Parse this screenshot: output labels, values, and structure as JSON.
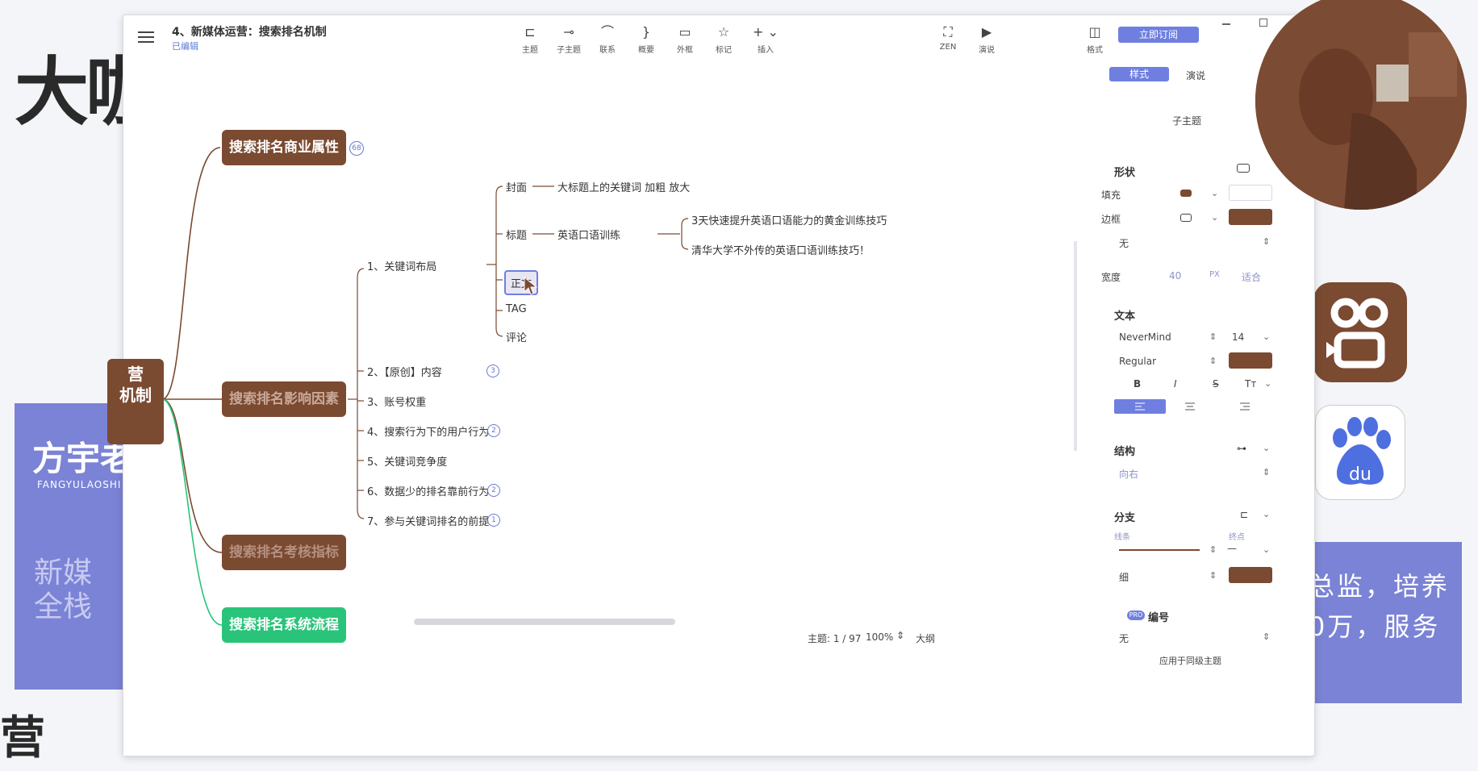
{
  "background": {
    "title": "大咖",
    "brand": "方宇老",
    "brand_en": "FANGYULAOSHI",
    "side_text": "新媒全栈",
    "right_line1": "总监，培养",
    "right_line2": "0万，服务",
    "bottom_text": "营"
  },
  "window": {
    "doc_title": "4、新媒体运营：搜索排名机制",
    "doc_status": "已编辑",
    "menu_icon": "hamburger-icon",
    "subscribe_label": "立即订阅",
    "format_label": "格式"
  },
  "toolbar": [
    {
      "label": "主题",
      "icon": "topic-icon"
    },
    {
      "label": "子主题",
      "icon": "subtopic-icon"
    },
    {
      "label": "联系",
      "icon": "relationship-icon"
    },
    {
      "label": "概要",
      "icon": "summary-icon"
    },
    {
      "label": "外框",
      "icon": "boundary-icon"
    },
    {
      "label": "标记",
      "icon": "marker-icon"
    },
    {
      "label": "插入",
      "icon": "insert-icon"
    },
    {
      "label": "ZEN",
      "icon": "zen-icon"
    },
    {
      "label": "演说",
      "icon": "pitch-icon"
    }
  ],
  "mindmap": {
    "root_line1": "营",
    "root_line2": "机制",
    "branches": [
      {
        "label": "搜索排名商业属性",
        "badge": "68"
      },
      {
        "label": "搜索排名影响因素",
        "badge": ""
      },
      {
        "label": "搜索排名考核指标",
        "badge": ""
      },
      {
        "label": "搜索排名系统流程",
        "badge": ""
      }
    ],
    "factors": [
      {
        "label": "1、关键词布局",
        "badge": ""
      },
      {
        "label": "2、【原创】内容",
        "badge": "3"
      },
      {
        "label": "3、账号权重",
        "badge": ""
      },
      {
        "label": "4、搜索行为下的用户行为",
        "badge": "2"
      },
      {
        "label": "5、关键词竞争度",
        "badge": ""
      },
      {
        "label": "6、数据少的排名靠前行为",
        "badge": "2"
      },
      {
        "label": "7、参与关键词排名的前提",
        "badge": "1"
      }
    ],
    "layout_items": [
      {
        "label": "封面"
      },
      {
        "label": "标题"
      },
      {
        "label": "正文"
      },
      {
        "label": "TAG"
      },
      {
        "label": "评论"
      }
    ],
    "cover_note": "大标题上的关键词 加粗 放大",
    "title_note": "英语口语训练",
    "title_examples": [
      "3天快速提升英语口语能力的黄金训练技巧",
      "清华大学不外传的英语口语训练技巧！"
    ]
  },
  "status": {
    "topic_count": "主题: 1 / 97",
    "zoom": "100%",
    "outline": "大纲"
  },
  "panel": {
    "tab_style": "样式",
    "tab_pitch": "演说",
    "node_type": "子主题",
    "shape_section": "形状",
    "fill_label": "填充",
    "border_label": "边框",
    "border_style": "无",
    "width_label": "宽度",
    "width_value": "40",
    "width_unit": "PX",
    "width_fit": "适合",
    "text_section": "文本",
    "font_name": "NeverMind",
    "font_size": "14",
    "font_weight": "Regular",
    "bold": "B",
    "italic": "I",
    "strike": "S",
    "case": "Tт",
    "structure_section": "结构",
    "structure_value": "向右",
    "branch_section": "分支",
    "line_label": "线条",
    "end_label": "终点",
    "thickness_value": "细",
    "numbering_badge": "PRO",
    "numbering_section": "编号",
    "numbering_value": "无",
    "apply_label": "应用于同级主题",
    "fill_color": "#7a4a31",
    "border_color": "#7a4a31",
    "branch_color": "#7a4a31"
  },
  "colors": {
    "brown": "#7a4a31",
    "green": "#29c47a",
    "accent": "#6f7fe0",
    "slide_purple": "#7b83d6"
  }
}
